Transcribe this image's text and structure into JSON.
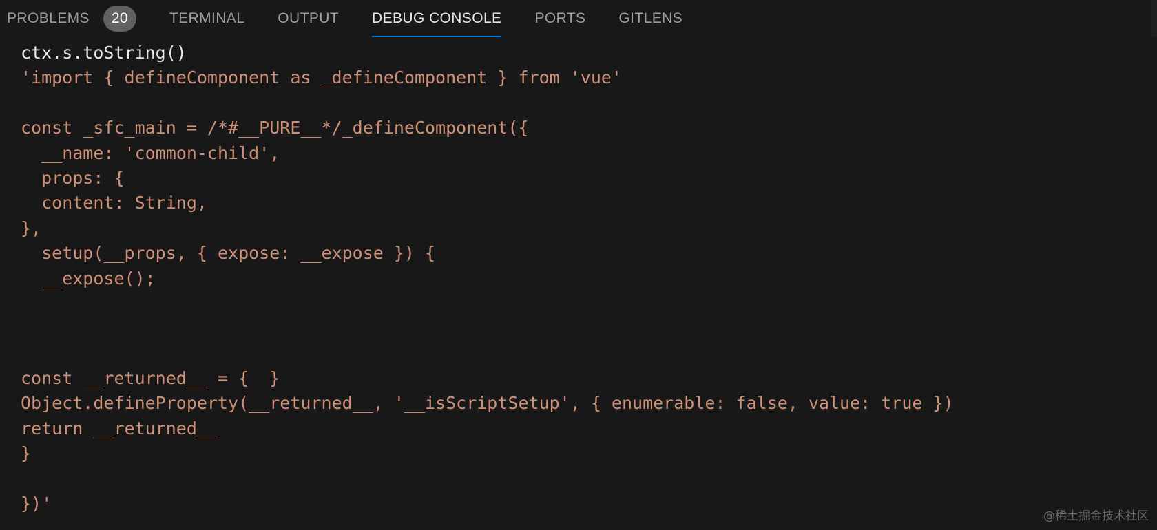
{
  "tabs": [
    {
      "label": "PROBLEMS",
      "badge": "20"
    },
    {
      "label": "TERMINAL"
    },
    {
      "label": "OUTPUT"
    },
    {
      "label": "DEBUG CONSOLE",
      "active": true
    },
    {
      "label": "PORTS"
    },
    {
      "label": "GITLENS"
    }
  ],
  "console": {
    "lines": [
      "ctx.s.toString()",
      "'import { defineComponent as _defineComponent } from 'vue'",
      "",
      "const _sfc_main = /*#__PURE__*/_defineComponent({",
      "  __name: 'common-child',",
      "  props: {",
      "  content: String,",
      "},",
      "  setup(__props, { expose: __expose }) {",
      "  __expose();",
      "",
      "",
      "",
      "const __returned__ = {  }",
      "Object.defineProperty(__returned__, '__isScriptSetup', { enumerable: false, value: true })",
      "return __returned__",
      "}",
      "",
      "})'"
    ]
  },
  "colors": {
    "background": "#181818",
    "string_output": "#ce9178",
    "input_text": "#e8e8e8",
    "active_tab_underline": "#0078d4",
    "badge_background": "#616161"
  },
  "watermark": "@稀土掘金技术社区"
}
